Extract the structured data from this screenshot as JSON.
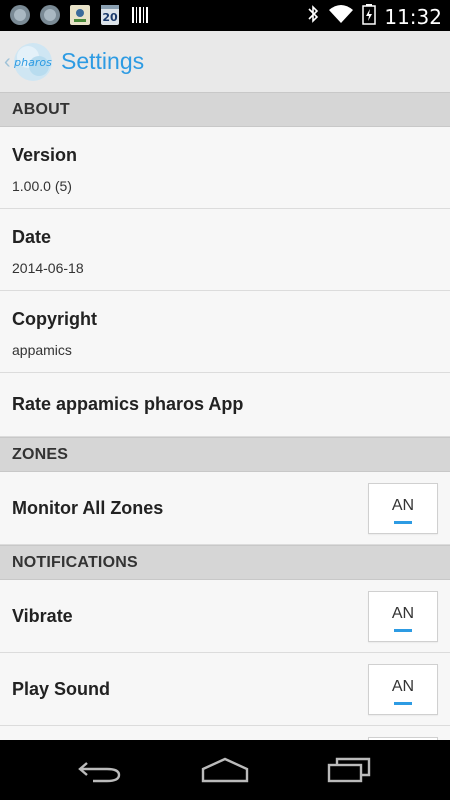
{
  "status_bar": {
    "time": "11:32",
    "icons": [
      "app-icon-1",
      "app-icon-2",
      "app-icon-3",
      "calendar-20-icon",
      "barcode-icon",
      "bluetooth-icon",
      "wifi-icon",
      "battery-icon"
    ],
    "calendar_day": "20"
  },
  "action_bar": {
    "logo_text": "pharos",
    "title": "Settings"
  },
  "sections": {
    "about": {
      "header": "ABOUT",
      "version_title": "Version",
      "version_value": "1.00.0 (5)",
      "date_title": "Date",
      "date_value": "2014-06-18",
      "copyright_title": "Copyright",
      "copyright_value": "appamics",
      "rate_title": "Rate appamics pharos App"
    },
    "zones": {
      "header": "ZONES",
      "monitor_title": "Monitor All Zones",
      "monitor_toggle": "AN"
    },
    "notifications": {
      "header": "NOTIFICATIONS",
      "vibrate_title": "Vibrate",
      "vibrate_toggle": "AN",
      "sound_title": "Play Sound",
      "sound_toggle": "AN"
    }
  },
  "colors": {
    "accent": "#2d9be3",
    "section_bg": "#d6d6d6",
    "row_bg": "#f7f7f7",
    "statusbar_bg": "#000000"
  }
}
